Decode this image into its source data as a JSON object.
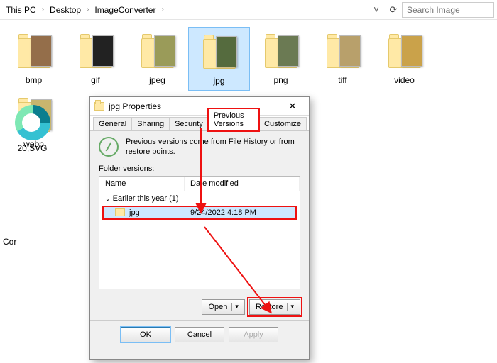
{
  "breadcrumbs": [
    "This PC",
    "Desktop",
    "ImageConverter"
  ],
  "search_placeholder": "Search Image",
  "folders": [
    {
      "label": "bmp",
      "color": "#946e4a"
    },
    {
      "label": "gif",
      "color": "#222"
    },
    {
      "label": "jpeg",
      "color": "#9a9b59"
    },
    {
      "label": "jpg",
      "color": "#556b3e",
      "selected": true
    },
    {
      "label": "png",
      "color": "#6b7a53"
    },
    {
      "label": "tiff",
      "color": "#b8a06b"
    },
    {
      "label": "video",
      "color": "#caa24a"
    },
    {
      "label": "webp",
      "color": "#c8b56e"
    }
  ],
  "edge_label": "20,SVG",
  "sidebar_cut": "Cor",
  "dialog": {
    "title": "jpg Properties",
    "tabs": [
      "General",
      "Sharing",
      "Security",
      "Previous Versions",
      "Customize"
    ],
    "active_tab": 3,
    "info_text": "Previous versions come from File History or from restore points.",
    "section_label": "Folder versions:",
    "columns": {
      "name": "Name",
      "date": "Date modified"
    },
    "group_label": "Earlier this year (1)",
    "rows": [
      {
        "name": "jpg",
        "date": "9/24/2022 4:18 PM",
        "selected": true
      }
    ],
    "buttons": {
      "open": "Open",
      "restore": "Restore"
    },
    "footer": {
      "ok": "OK",
      "cancel": "Cancel",
      "apply": "Apply"
    },
    "highlight_color": "#e11"
  }
}
